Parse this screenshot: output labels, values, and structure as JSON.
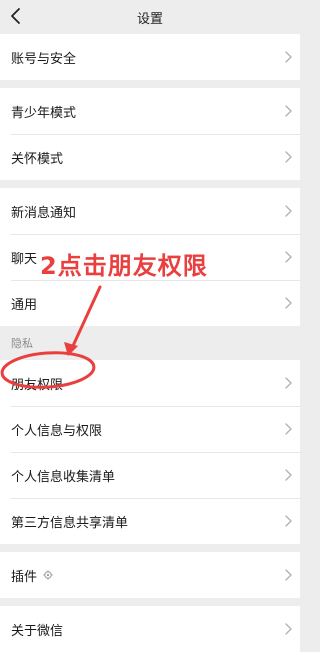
{
  "header": {
    "title": "设置",
    "back_icon": "chevron-left-icon"
  },
  "groups": {
    "account": {
      "items": [
        {
          "label": "账号与安全"
        }
      ]
    },
    "modes": {
      "items": [
        {
          "label": "青少年模式"
        },
        {
          "label": "关怀模式"
        }
      ]
    },
    "general": {
      "items": [
        {
          "label": "新消息通知"
        },
        {
          "label": "聊天"
        },
        {
          "label": "通用"
        }
      ]
    },
    "privacy": {
      "section_label": "隐私",
      "items": [
        {
          "label": "朋友权限"
        },
        {
          "label": "个人信息与权限"
        },
        {
          "label": "个人信息收集清单"
        },
        {
          "label": "第三方信息共享清单"
        }
      ]
    },
    "plugins": {
      "items": [
        {
          "label": "插件",
          "icon": "gear-icon"
        }
      ]
    },
    "about": {
      "items": [
        {
          "label": "关于微信"
        }
      ]
    }
  },
  "annotation": {
    "text": "2点击朋友权限",
    "color": "#ea3f3f"
  },
  "colors": {
    "background": "#ededed",
    "row_background": "#ffffff",
    "chevron": "#b2b2b2",
    "annotation": "#ea3f3f"
  }
}
